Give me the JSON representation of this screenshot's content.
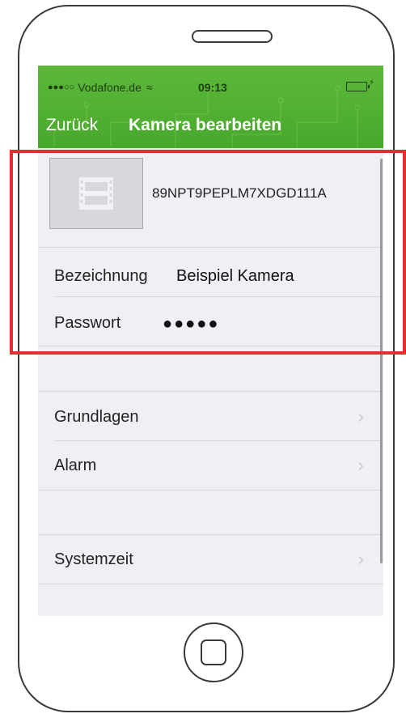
{
  "status_bar": {
    "signal": "●●●○○",
    "carrier": "Vodafone.de",
    "wifi_glyph": "≈",
    "time": "09:13",
    "bolt": "⚡"
  },
  "nav": {
    "back_label": "Zurück",
    "title": "Kamera bearbeiten"
  },
  "camera": {
    "id": "89NPT9PEPLM7XDGD111A"
  },
  "fields": {
    "name_label": "Bezeichnung",
    "name_value": "Beispiel Kamera",
    "password_label": "Passwort",
    "password_value": "●●●●●"
  },
  "menu": {
    "items": [
      {
        "label": "Grundlagen",
        "chevron": "›"
      },
      {
        "label": "Alarm",
        "chevron": "›"
      },
      {
        "label": "Systemzeit",
        "chevron": "›"
      }
    ]
  },
  "colors": {
    "nav_green": "#4cab2f",
    "highlight_red": "#e23030",
    "background": "#efeff4"
  }
}
